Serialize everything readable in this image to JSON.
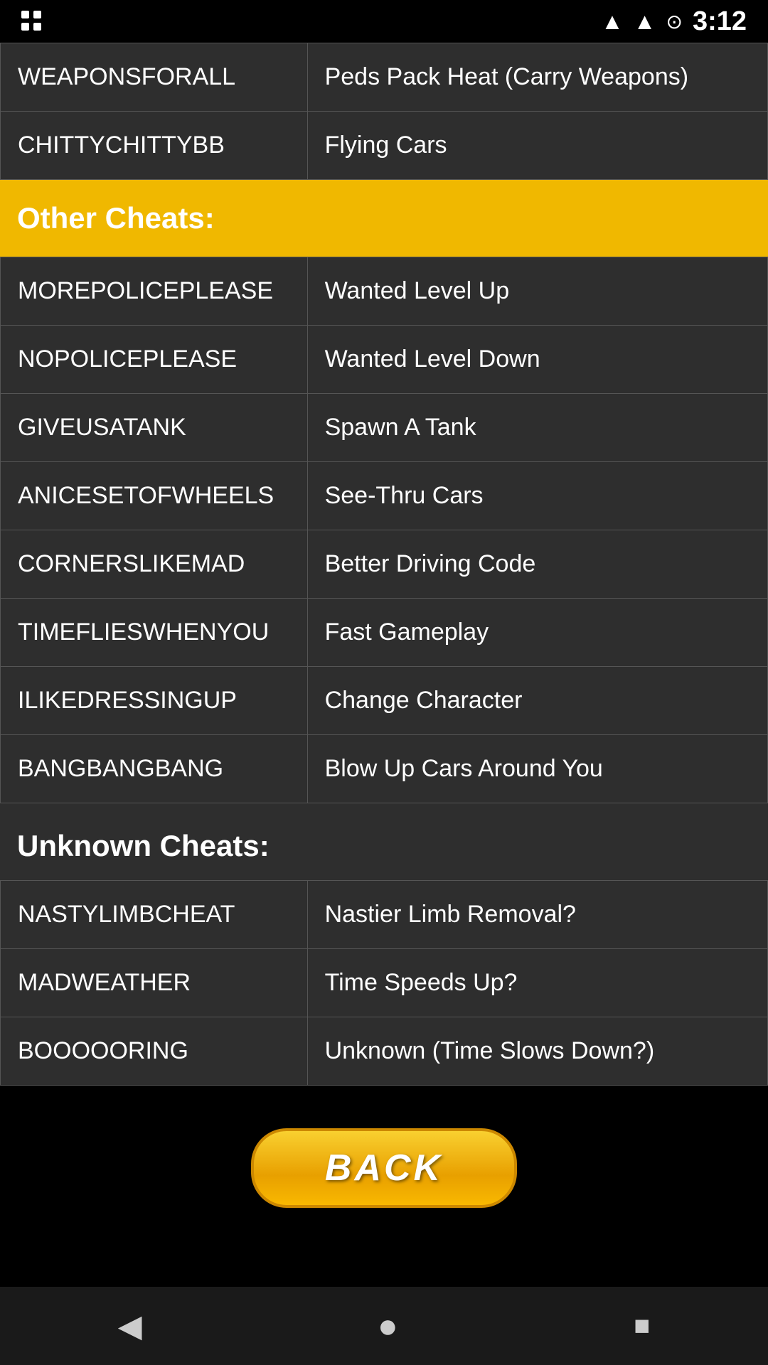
{
  "status_bar": {
    "time": "3:12"
  },
  "top_rows": [
    {
      "code": "WEAPONSFORALL",
      "effect": "Peds Pack Heat (Carry Weapons)"
    },
    {
      "code": "CHITTYCHIТTYBB",
      "effect": "Flying Cars"
    }
  ],
  "other_cheats_header": "Other Cheats:",
  "other_cheats": [
    {
      "code": "MOREPOLICEPLEASE",
      "effect": "Wanted Level Up"
    },
    {
      "code": "NOPOLICEPLEASE",
      "effect": "Wanted Level Down"
    },
    {
      "code": "GIVEUSATANK",
      "effect": "Spawn A Tank"
    },
    {
      "code": "ANICESETOFWHEELS",
      "effect": "See-Thru Cars"
    },
    {
      "code": "CORNERSLIKEMAD",
      "effect": "Better Driving Code"
    },
    {
      "code": "TIMEFLIESWHENYOU",
      "effect": "Fast Gameplay"
    },
    {
      "code": "ILIKEDRESSINGUP",
      "effect": "Change Character"
    },
    {
      "code": "BANGBANGBANG",
      "effect": "Blow Up Cars Around You"
    }
  ],
  "unknown_cheats_header": "Unknown Cheats:",
  "unknown_cheats": [
    {
      "code": "NASTYLIMBCHEAT",
      "effect": "Nastier Limb Removal?"
    },
    {
      "code": "MADWEATHER",
      "effect": "Time Speeds Up?"
    },
    {
      "code": "BOOOOORING",
      "effect": "Unknown (Time Slows Down?)"
    }
  ],
  "back_button_label": "BACK"
}
